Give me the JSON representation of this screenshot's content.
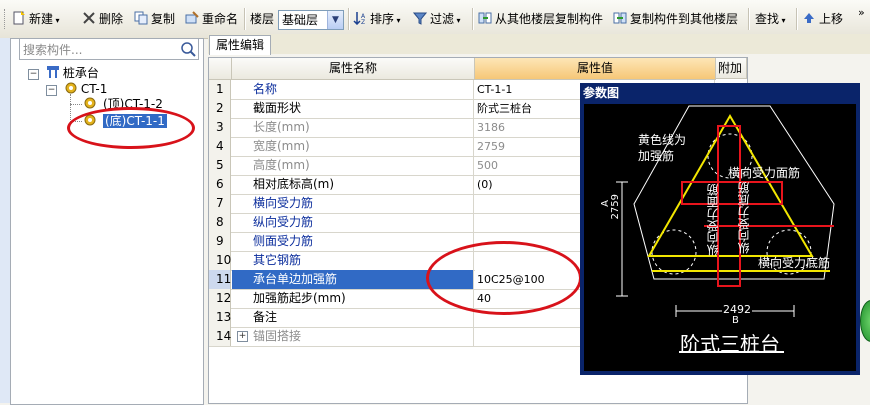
{
  "toolbar": {
    "new_label": "新建",
    "delete_label": "删除",
    "copy_label": "复制",
    "rename_label": "重命名",
    "floor_label": "楼层",
    "floor_value": "基础层",
    "sort_label": "排序",
    "filter_label": "过滤",
    "copy_from_floor_label": "从其他楼层复制构件",
    "copy_to_floor_label": "复制构件到其他楼层",
    "find_label": "查找",
    "move_up_label": "上移",
    "more_label": "»"
  },
  "search": {
    "placeholder": "搜索构件..."
  },
  "tree": {
    "root_label": "桩承台",
    "group_label": "CT-1",
    "child_top_label": "(顶)CT-1-2",
    "child_bottom_label": "(底)CT-1-1"
  },
  "property_panel": {
    "tab_label": "属性编辑",
    "col_name": "属性名称",
    "col_value": "属性值",
    "col_extra": "附加",
    "rows": [
      {
        "no": "1",
        "name": "名称",
        "value": "CT-1-1"
      },
      {
        "no": "2",
        "name": "截面形状",
        "value": "阶式三桩台"
      },
      {
        "no": "3",
        "name": "长度(mm)",
        "value": "3186"
      },
      {
        "no": "4",
        "name": "宽度(mm)",
        "value": "2759"
      },
      {
        "no": "5",
        "name": "高度(mm)",
        "value": "500"
      },
      {
        "no": "6",
        "name": "相对底标高(m)",
        "value": "(0)"
      },
      {
        "no": "7",
        "name": "横向受力筋",
        "value": ""
      },
      {
        "no": "8",
        "name": "纵向受力筋",
        "value": ""
      },
      {
        "no": "9",
        "name": "侧面受力筋",
        "value": ""
      },
      {
        "no": "10",
        "name": "其它钢筋",
        "value": ""
      },
      {
        "no": "11",
        "name": "承台单边加强筋",
        "value": "10C25@100"
      },
      {
        "no": "12",
        "name": "加强筋起步(mm)",
        "value": "40"
      },
      {
        "no": "13",
        "name": "备注",
        "value": ""
      },
      {
        "no": "14",
        "name": "锚固搭接",
        "value": ""
      }
    ]
  },
  "param_window": {
    "title": "参数图",
    "note_line1": "黄色线为",
    "note_line2": "加强筋",
    "label_transverse_face": "横向受力面筋",
    "label_longitudinal_face": "纵向受力面筋",
    "label_longitudinal_bottom": "纵向受力底筋",
    "label_transverse_bottom": "横向受力底筋",
    "dim_a_letter": "A",
    "dim_a_value": "2759",
    "dim_b_value": "2492",
    "dim_b_letter": "B",
    "caption": "阶式三桩台"
  },
  "colors": {
    "selection": "#316ac5",
    "highlight_ellipse": "#d8121a",
    "reinforcement_yellow": "#f2e600",
    "rebar_red": "#e8141c",
    "header_value_bg": "#f6c777"
  }
}
